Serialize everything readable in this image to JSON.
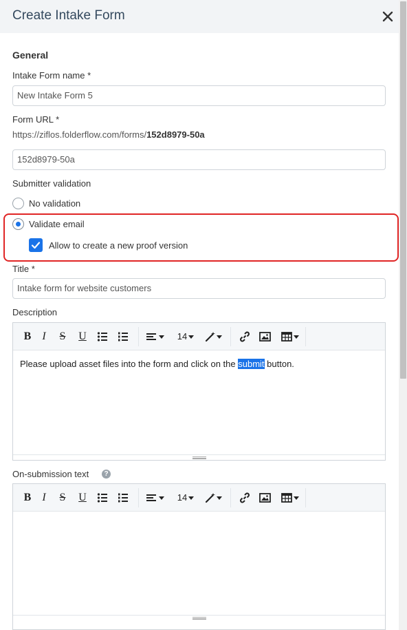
{
  "dialog": {
    "title": "Create Intake Form",
    "close_icon": "close-icon"
  },
  "general": {
    "section_title": "General",
    "name_label": "Intake Form name *",
    "name_value": "New Intake Form 5",
    "url_label": "Form URL *",
    "url_prefix": "https://ziflos.folderflow.com/forms/",
    "url_slug": "152d8979-50a",
    "slug_value": "152d8979-50a"
  },
  "validation": {
    "label": "Submitter validation",
    "options": [
      {
        "label": "No validation",
        "selected": false
      },
      {
        "label": "Validate email",
        "selected": true
      }
    ],
    "checkbox_label": "Allow to create a new proof version",
    "checkbox_checked": true,
    "highlight_color": "#e02424"
  },
  "title_field": {
    "label": "Title *",
    "value": "Intake form for website customers"
  },
  "description": {
    "label": "Description",
    "text_before": "Please upload asset files into the form and click on the ",
    "text_selected": "submit",
    "text_after": " button."
  },
  "on_submission": {
    "label": "On-submission text",
    "help_icon": "?"
  },
  "toolbar": {
    "bold": "B",
    "italic": "I",
    "strike": "S",
    "underline": "U",
    "font_size": "14",
    "icons": [
      "bold-icon",
      "italic-icon",
      "strikethrough-icon",
      "underline-icon",
      "bullet-list-icon",
      "numbered-list-icon",
      "align-icon",
      "font-size-dropdown",
      "magic-wand-icon",
      "link-icon",
      "image-icon",
      "table-icon"
    ]
  },
  "colors": {
    "accent": "#1a73e8",
    "header_bg": "#f2f4f6",
    "toolbar_bg": "#f5f7f9"
  }
}
